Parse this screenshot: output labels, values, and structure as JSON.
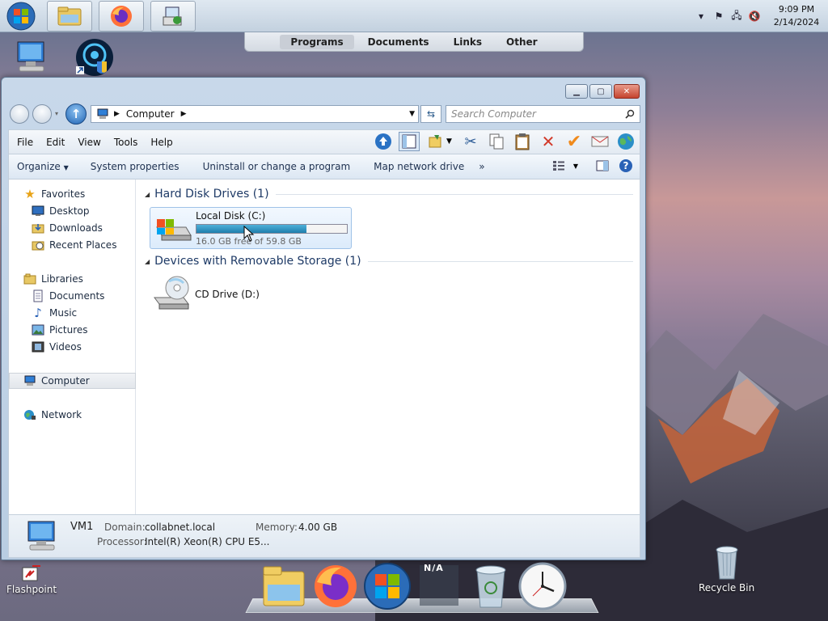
{
  "taskbar": {
    "clock_time": "9:09 PM",
    "clock_date": "2/14/2024",
    "tray_icons": [
      "chevron-up-icon",
      "flag-icon",
      "network-icon",
      "volume-muted-icon"
    ]
  },
  "quick_tabs": [
    {
      "label": "Programs",
      "active": true
    },
    {
      "label": "Documents",
      "active": false
    },
    {
      "label": "Links",
      "active": false
    },
    {
      "label": "Other",
      "active": false
    }
  ],
  "desktop": {
    "flashpoint_label": "Flashpoint",
    "recycle_bin_label": "Recycle Bin"
  },
  "window": {
    "breadcrumb": "Computer",
    "search_placeholder": "Search Computer",
    "menu": [
      "File",
      "Edit",
      "View",
      "Tools",
      "Help"
    ],
    "commands": [
      "Organize",
      "System properties",
      "Uninstall or change a program",
      "Map network drive",
      "»"
    ],
    "nav": {
      "favorites": "Favorites",
      "desktop": "Desktop",
      "downloads": "Downloads",
      "recent_places": "Recent Places",
      "libraries": "Libraries",
      "documents": "Documents",
      "music": "Music",
      "pictures": "Pictures",
      "videos": "Videos",
      "computer": "Computer",
      "network": "Network"
    },
    "groups": {
      "hdd": "Hard Disk Drives (1)",
      "removable": "Devices with Removable Storage (1)"
    },
    "drive_c": {
      "name": "Local Disk (C:)",
      "free_text": "16.0 GB free of 59.8 GB",
      "used_fraction": 0.732
    },
    "drive_d": {
      "name": "CD Drive (D:)"
    },
    "details": {
      "computer_name": "VM1",
      "domain_label": "Domain:",
      "domain_value": "collabnet.local",
      "memory_label": "Memory:",
      "memory_value": "4.00 GB",
      "processor_label": "Processor:",
      "processor_value": "Intel(R) Xeon(R) CPU E5..."
    }
  },
  "dock": {
    "items": [
      "folder-icon",
      "firefox-icon",
      "windows-orb-icon",
      "network-status-icon",
      "recycle-bin-icon",
      "clock-icon"
    ],
    "na_badge": "N/A"
  },
  "colors": {
    "accent": "#1f63b3",
    "drive_fill": "#1f7fae",
    "close_red": "#c5442f"
  }
}
